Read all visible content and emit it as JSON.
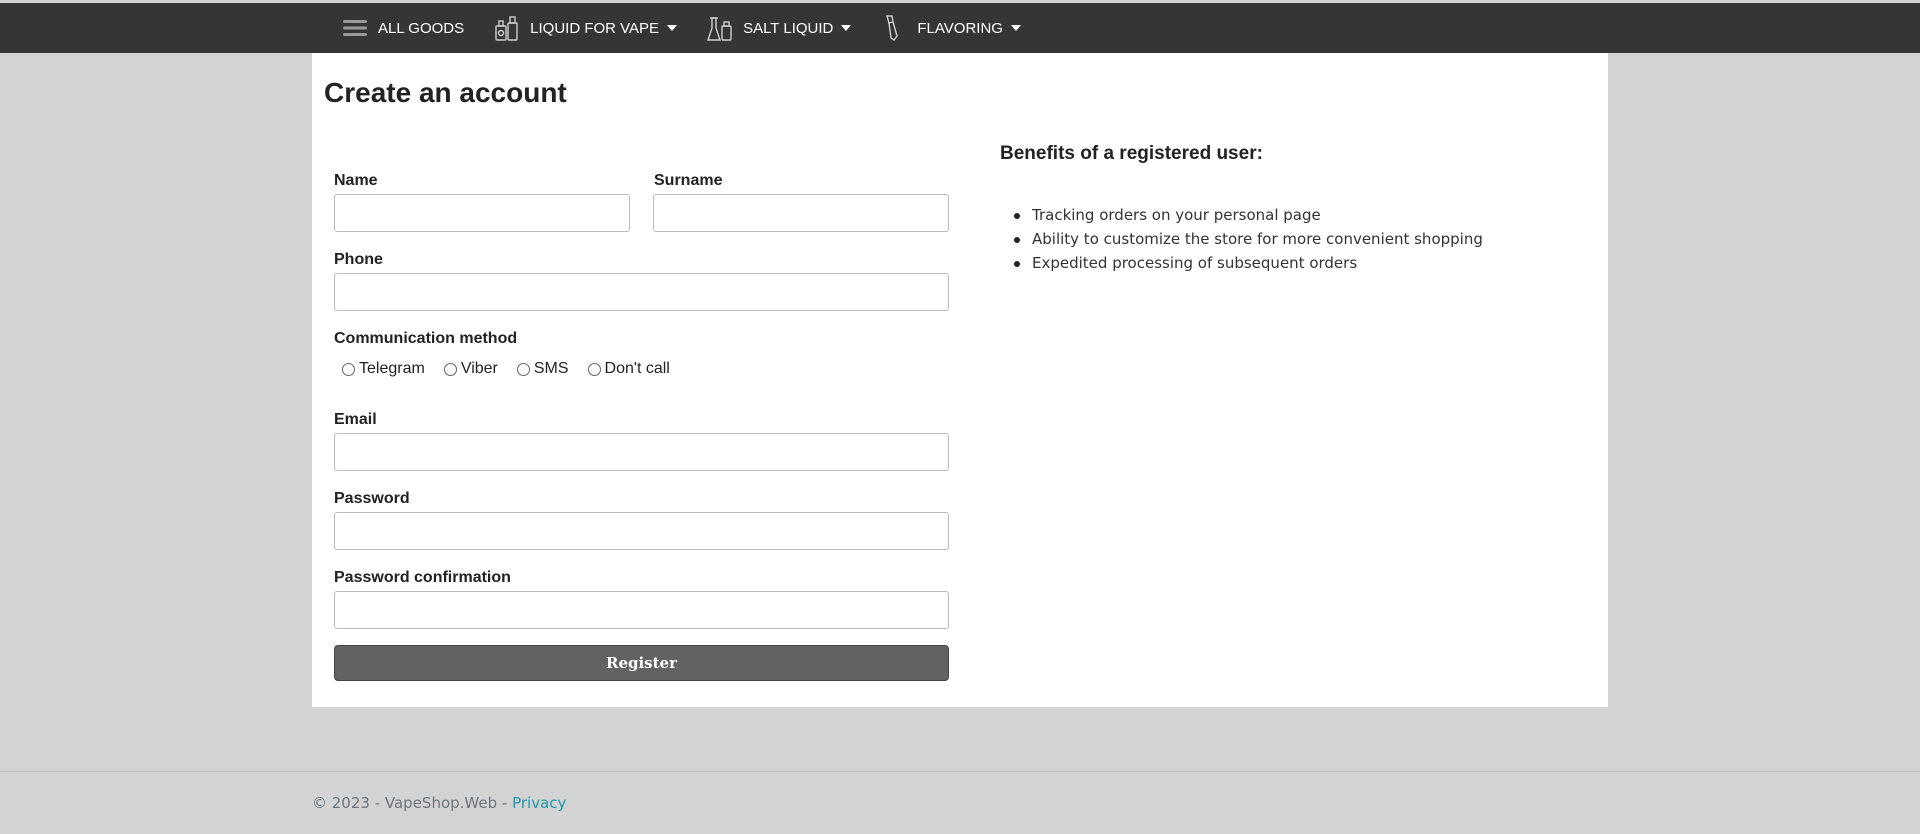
{
  "nav": {
    "items": [
      {
        "label": "ALL GOODS",
        "icon": "menu-icon",
        "dropdown": false
      },
      {
        "label": "LIQUID FOR VAPE",
        "icon": "bottles-icon",
        "dropdown": true
      },
      {
        "label": "SALT LIQUID",
        "icon": "flask-icon",
        "dropdown": true
      },
      {
        "label": "FLAVORING",
        "icon": "dropper-icon",
        "dropdown": true
      }
    ]
  },
  "page": {
    "title": "Create an account"
  },
  "form": {
    "name_label": "Name",
    "surname_label": "Surname",
    "phone_label": "Phone",
    "comm_label": "Communication method",
    "comm_options": [
      "Telegram",
      "Viber",
      "SMS",
      "Don't call"
    ],
    "email_label": "Email",
    "password_label": "Password",
    "password_confirm_label": "Password confirmation",
    "register_label": "Register"
  },
  "benefits": {
    "title": "Benefits of a registered user:",
    "items": [
      "Tracking orders on your personal page",
      "Ability to customize the store for more convenient shopping",
      "Expedited processing of subsequent orders"
    ]
  },
  "footer": {
    "text": "© 2023 - VapeShop.Web - ",
    "privacy_link": "Privacy"
  },
  "colors": {
    "topbar": "#353535",
    "background": "#d3d3d3",
    "button": "#626262",
    "link": "#1b9aaa"
  }
}
